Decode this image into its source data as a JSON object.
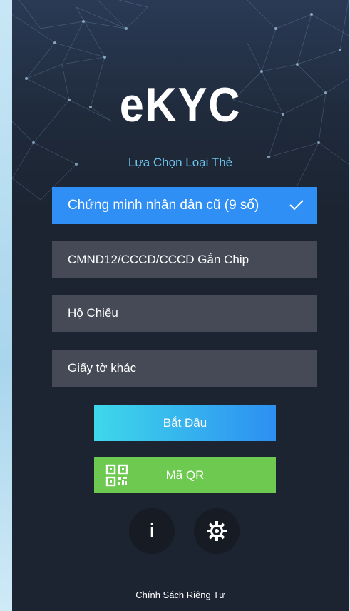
{
  "app": {
    "title": "eKYC",
    "subtitle": "Lựa Chọn Loại Thẻ"
  },
  "card_types": [
    {
      "label": "Chứng minh nhân dân cũ (9 số)",
      "selected": true
    },
    {
      "label": "CMND12/CCCD/CCCD Gắn Chip",
      "selected": false
    },
    {
      "label": "Hộ Chiếu",
      "selected": false
    },
    {
      "label": "Giấy tờ khác",
      "selected": false
    }
  ],
  "actions": {
    "start_label": "Bắt Đầu",
    "qr_label": "Mã QR",
    "info_label": "i"
  },
  "footer": {
    "privacy_label": "Chính Sách Riêng Tư"
  },
  "icons": {
    "check": "check-icon",
    "qr": "qr-code-icon",
    "settings": "gear-icon"
  },
  "colors": {
    "accent": "#2f8ff4",
    "qr_green": "#6ec950",
    "subtitle": "#6fc4ee",
    "background": "#1c2431",
    "option": "#454a56"
  }
}
